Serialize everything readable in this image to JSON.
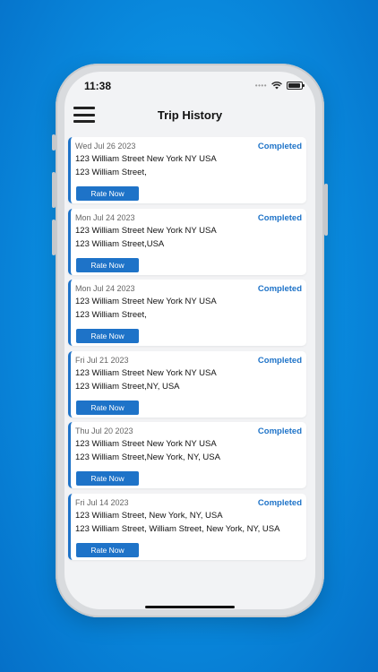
{
  "status_bar": {
    "time": "11:38",
    "signal_dots": "••••"
  },
  "header": {
    "title": "Trip History",
    "menu_icon": "hamburger-menu-icon"
  },
  "trips": [
    {
      "date": "Wed Jul 26 2023",
      "status": "Completed",
      "pickup": "123 William Street New York NY USA",
      "dropoff": "123 William Street,",
      "action": "Rate Now"
    },
    {
      "date": "Mon Jul 24 2023",
      "status": "Completed",
      "pickup": "123 William Street New York NY USA",
      "dropoff": "123 William Street,USA",
      "action": "Rate Now"
    },
    {
      "date": "Mon Jul 24 2023",
      "status": "Completed",
      "pickup": "123 William Street New York NY USA",
      "dropoff": "123 William Street,",
      "action": "Rate Now"
    },
    {
      "date": "Fri Jul 21 2023",
      "status": "Completed",
      "pickup": "123 William Street New York NY USA",
      "dropoff": "123 William Street,NY, USA",
      "action": "Rate Now"
    },
    {
      "date": "Thu Jul 20 2023",
      "status": "Completed",
      "pickup": "123 William Street New York NY USA",
      "dropoff": "123 William Street,New York, NY, USA",
      "action": "Rate Now"
    },
    {
      "date": "Fri Jul 14 2023",
      "status": "Completed",
      "pickup": "123 William Street, New York, NY, USA",
      "dropoff": "123 William Street, William Street, New York, NY, USA",
      "action": "Rate Now"
    }
  ],
  "colors": {
    "accent": "#1e73c8",
    "background": "#0a8fe2",
    "screen": "#f2f3f5"
  }
}
